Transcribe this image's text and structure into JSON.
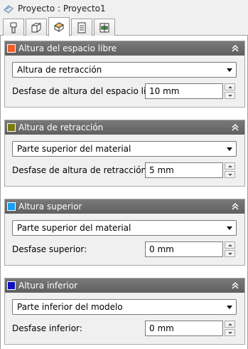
{
  "window": {
    "title": "Proyecto : Proyecto1",
    "icon": "project-icon"
  },
  "tabs": [
    {
      "icon": "tool-icon"
    },
    {
      "icon": "stock-icon"
    },
    {
      "icon": "heights-icon",
      "active": true
    },
    {
      "icon": "sheet-icon"
    },
    {
      "icon": "setup-icon"
    }
  ],
  "panels": [
    {
      "title": "Altura del espacio libre",
      "color": "#f25c2a",
      "select": "Altura de retracción",
      "label": "Desfase de altura del espacio lib...",
      "value": "10 mm"
    },
    {
      "title": "Altura de retracción",
      "color": "#7a7a10",
      "select": "Parte superior del material",
      "label": "Desfase de altura de retracción:",
      "value": "5 mm"
    },
    {
      "title": "Altura superior",
      "color": "#1a9df0",
      "select": "Parte superior del material",
      "label": "Desfase superior:",
      "value": "0 mm"
    },
    {
      "title": "Altura inferior",
      "color": "#1010c0",
      "select": "Parte inferior del modelo",
      "label": "Desfase inferior:",
      "value": "0 mm"
    }
  ]
}
